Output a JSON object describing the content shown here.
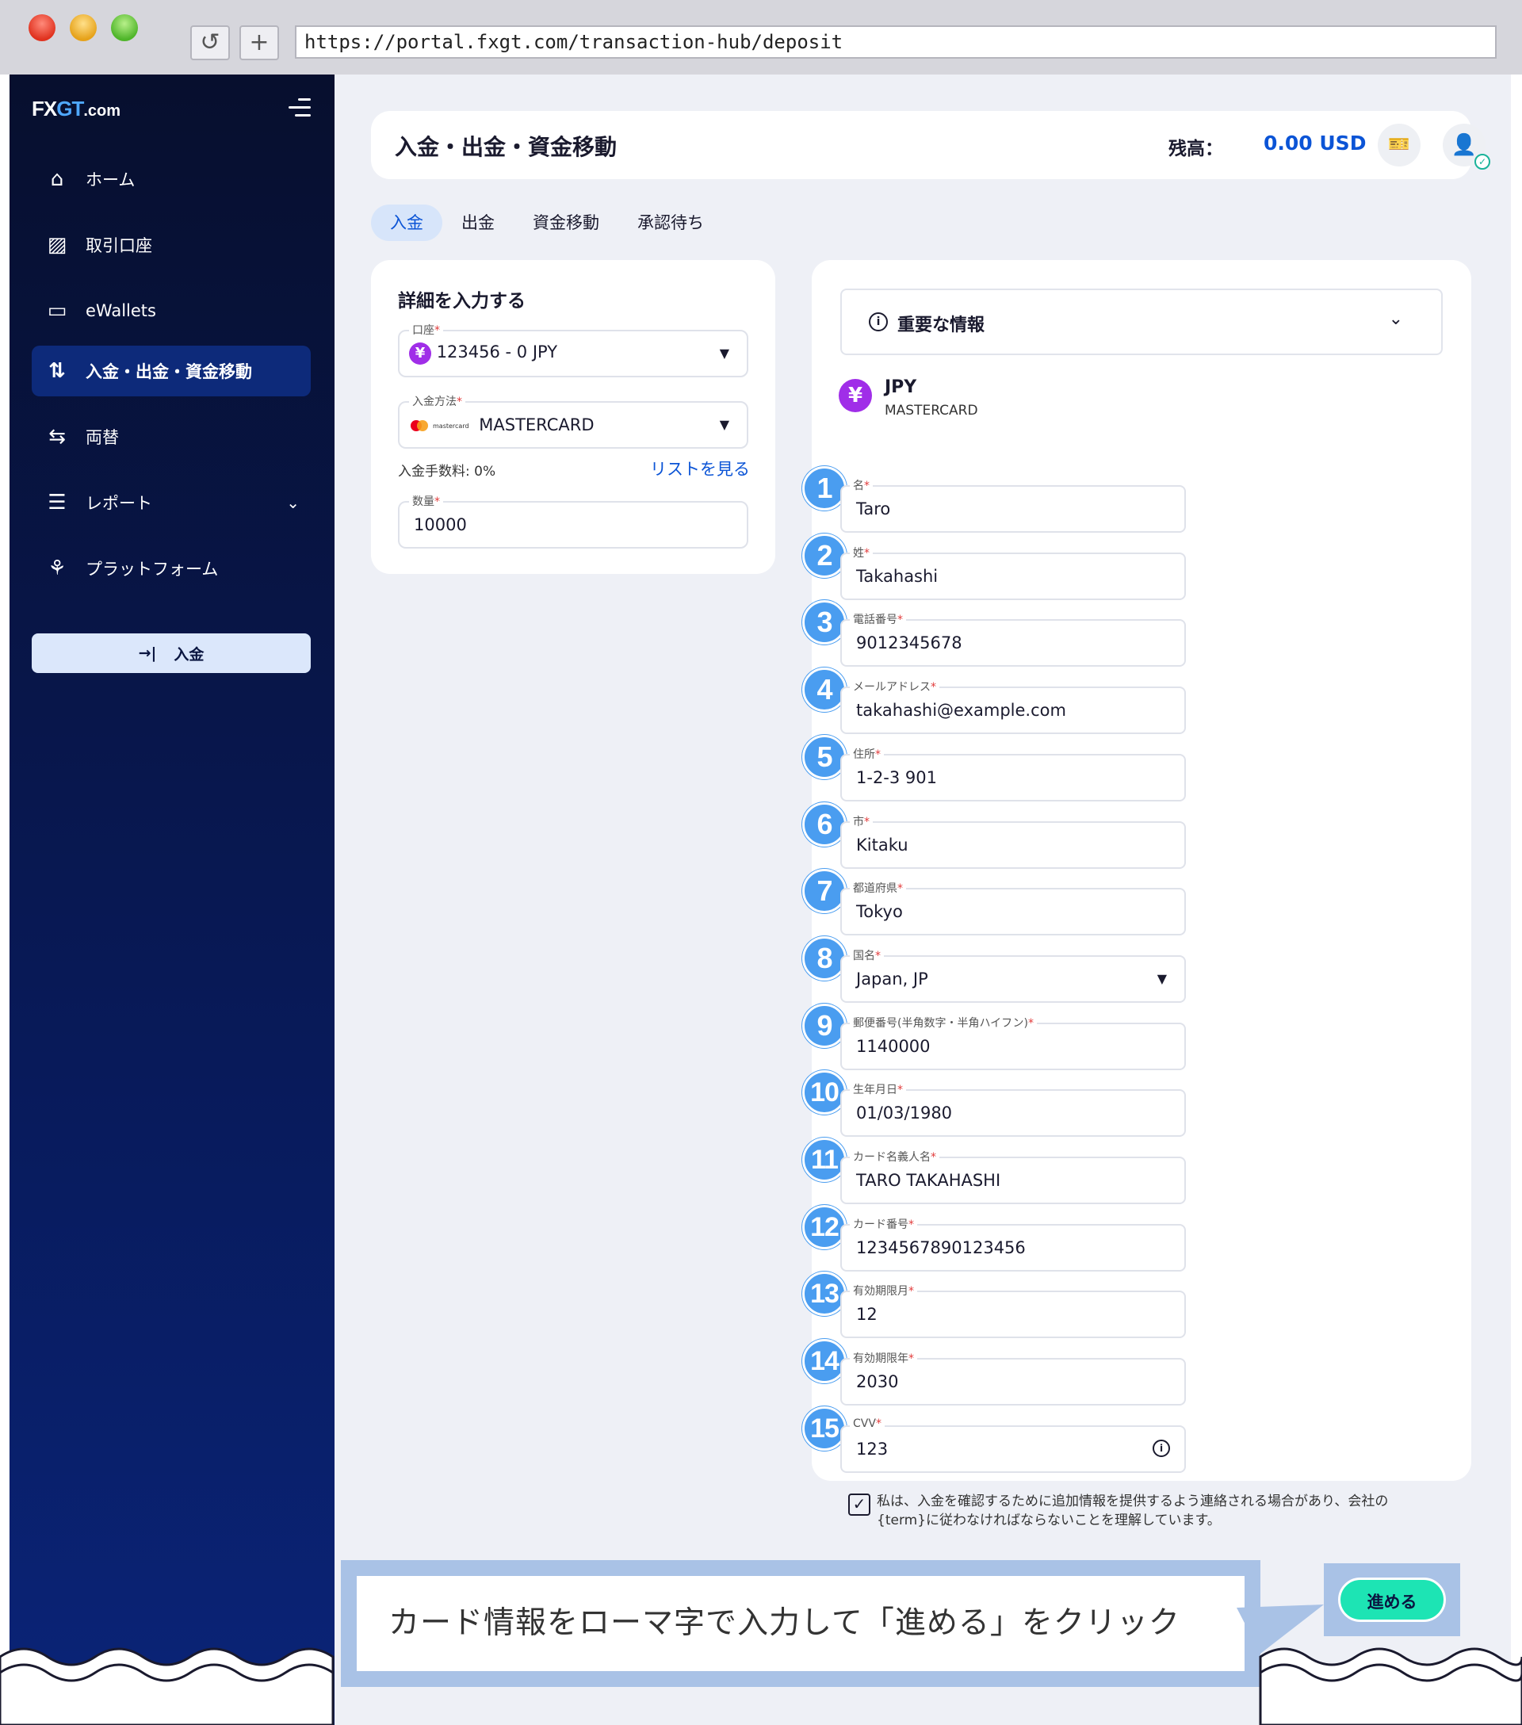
{
  "browser": {
    "url": "https://portal.fxgt.com/transaction-hub/deposit",
    "reload_icon": "↺",
    "newtab_icon": "+"
  },
  "sidebar": {
    "logo": {
      "fx": "FX",
      "gt": "GT",
      "com": ".com"
    },
    "items": [
      {
        "label": "ホーム",
        "icon": "⌂"
      },
      {
        "label": "取引口座",
        "icon": "▨"
      },
      {
        "label": "eWallets",
        "icon": "▭"
      },
      {
        "label": "入金・出金・資金移動",
        "icon": "⇅"
      },
      {
        "label": "両替",
        "icon": "⇆"
      },
      {
        "label": "レポート",
        "icon": "☰",
        "chevron": "⌄"
      },
      {
        "label": "プラットフォーム",
        "icon": "⚘"
      }
    ],
    "cta": {
      "icon": "→|",
      "label": "入金"
    }
  },
  "header": {
    "title": "入金・出金・資金移動",
    "balance_label": "残高：",
    "balance_value": "0.00 USD"
  },
  "tabs": [
    "入金",
    "出金",
    "資金移動",
    "承認待ち"
  ],
  "details": {
    "heading": "詳細を入力する",
    "account": {
      "label": "口座",
      "badge": "¥",
      "value": "123456 - 0 JPY"
    },
    "method": {
      "label": "入金方法",
      "brand_word": "mastercard",
      "value": "MASTERCARD"
    },
    "fee": "入金手数料: 0%",
    "list_link": "リストを見る",
    "amount": {
      "label": "数量",
      "value": "10000"
    }
  },
  "info": {
    "title": "重要な情報",
    "currency_badge": "¥",
    "currency": "JPY",
    "method": "MASTERCARD"
  },
  "form_fields": [
    {
      "num": "1",
      "label": "名",
      "value": "Taro"
    },
    {
      "num": "2",
      "label": "姓",
      "value": "Takahashi"
    },
    {
      "num": "3",
      "label": "電話番号",
      "value": "9012345678"
    },
    {
      "num": "4",
      "label": "メールアドレス",
      "value": "takahashi@example.com"
    },
    {
      "num": "5",
      "label": "住所",
      "value": "1-2-3 901"
    },
    {
      "num": "6",
      "label": "市",
      "value": "Kitaku"
    },
    {
      "num": "7",
      "label": "都道府県",
      "value": "Tokyo"
    },
    {
      "num": "8",
      "label": "国名",
      "value": "Japan, JP"
    },
    {
      "num": "9",
      "label": "郵便番号(半角数字・半角ハイフン)",
      "value": "1140000"
    },
    {
      "num": "10",
      "label": "生年月日",
      "value": "01/03/1980"
    },
    {
      "num": "11",
      "label": "カード名義人名",
      "value": "TARO TAKAHASHI"
    },
    {
      "num": "12",
      "label": "カード番号",
      "value": "1234567890123456"
    },
    {
      "num": "13",
      "label": "有効期限月",
      "value": "12"
    },
    {
      "num": "14",
      "label": "有効期限年",
      "value": "2030"
    },
    {
      "num": "15",
      "label": "CVV",
      "value": "123"
    }
  ],
  "required_mark": "*",
  "consent": {
    "checked": "✓",
    "text": "私は、入金を確認するために追加情報を提供するよう連絡される場合があり、会社の{term}に従わなければならないことを理解しています。"
  },
  "proceed_label": "進める",
  "annotation": "カード情報をローマ字で入力して「進める」をクリック",
  "colors": {
    "accent": "#0b54d6",
    "proceed": "#1de4b4",
    "badge": "#a02ee8",
    "step": "#4a9df0"
  }
}
